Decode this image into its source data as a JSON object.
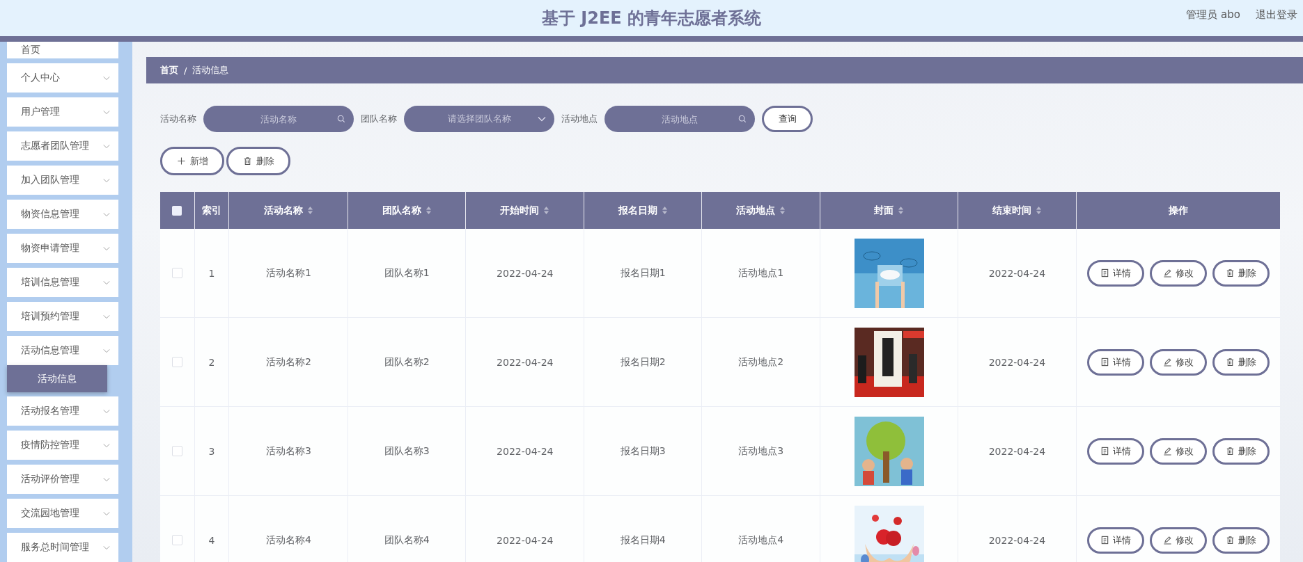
{
  "header": {
    "title": "基于 J2EE 的青年志愿者系统",
    "user": "管理员 abo",
    "logout": "退出登录"
  },
  "sidebar": {
    "items": [
      {
        "label": "首页",
        "kind": "link"
      },
      {
        "label": "个人中心",
        "kind": "menu"
      },
      {
        "label": "用户管理",
        "kind": "menu"
      },
      {
        "label": "志愿者团队管理",
        "kind": "menu"
      },
      {
        "label": "加入团队管理",
        "kind": "menu"
      },
      {
        "label": "物资信息管理",
        "kind": "menu"
      },
      {
        "label": "物资申请管理",
        "kind": "menu"
      },
      {
        "label": "培训信息管理",
        "kind": "menu"
      },
      {
        "label": "培训预约管理",
        "kind": "menu"
      },
      {
        "label": "活动信息管理",
        "kind": "menu",
        "children": [
          {
            "label": "活动信息",
            "selected": true
          }
        ]
      },
      {
        "label": "活动报名管理",
        "kind": "menu"
      },
      {
        "label": "疫情防控管理",
        "kind": "menu"
      },
      {
        "label": "活动评价管理",
        "kind": "menu"
      },
      {
        "label": "交流园地管理",
        "kind": "menu"
      },
      {
        "label": "服务总时间管理",
        "kind": "menu"
      }
    ]
  },
  "breadcrumb": {
    "items": [
      "首页",
      "活动信息"
    ],
    "separator": "/"
  },
  "search": {
    "fields": [
      {
        "label": "活动名称",
        "placeholder": "活动名称",
        "kind": "text"
      },
      {
        "label": "团队名称",
        "placeholder": "请选择团队名称",
        "kind": "select"
      },
      {
        "label": "活动地点",
        "placeholder": "活动地点",
        "kind": "text"
      }
    ],
    "button": "查询"
  },
  "actions": [
    {
      "label": "新增",
      "kind": "add"
    },
    {
      "label": "删除",
      "kind": "delete"
    }
  ],
  "table": {
    "select_all": {
      "checked": false
    },
    "columns": [
      {
        "label": "索引",
        "sortable": false
      },
      {
        "label": "活动名称",
        "sortable": true
      },
      {
        "label": "团队名称",
        "sortable": true
      },
      {
        "label": "开始时间",
        "sortable": true
      },
      {
        "label": "报名日期",
        "sortable": true
      },
      {
        "label": "活动地点",
        "sortable": true
      },
      {
        "label": "封面",
        "sortable": true
      },
      {
        "label": "结束时间",
        "sortable": true
      },
      {
        "label": "操作",
        "sortable": false
      }
    ],
    "rows": [
      {
        "checked": false,
        "cells": [
          "1",
          "活动名称1",
          "团队名称1",
          "2022-04-24",
          "报名日期1",
          "活动地点1",
          {
            "kind": "picture"
          },
          "2022-04-24"
        ],
        "ops": [
          {
            "label": "详情",
            "kind": "detail"
          },
          {
            "label": "修改",
            "kind": "edit"
          },
          {
            "label": "删除",
            "kind": "delete"
          }
        ]
      },
      {
        "checked": false,
        "cells": [
          "2",
          "活动名称2",
          "团队名称2",
          "2022-04-24",
          "报名日期2",
          "活动地点2",
          {
            "kind": "picture"
          },
          "2022-04-24"
        ],
        "ops": [
          {
            "label": "详情",
            "kind": "detail"
          },
          {
            "label": "修改",
            "kind": "edit"
          },
          {
            "label": "删除",
            "kind": "delete"
          }
        ]
      },
      {
        "checked": false,
        "cells": [
          "3",
          "活动名称3",
          "团队名称3",
          "2022-04-24",
          "报名日期3",
          "活动地点3",
          {
            "kind": "picture"
          },
          "2022-04-24"
        ],
        "ops": [
          {
            "label": "详情",
            "kind": "detail"
          },
          {
            "label": "修改",
            "kind": "edit"
          },
          {
            "label": "删除",
            "kind": "delete"
          }
        ]
      },
      {
        "checked": false,
        "cells": [
          "4",
          "活动名称4",
          "团队名称4",
          "2022-04-24",
          "报名日期4",
          "活动地点4",
          {
            "kind": "picture"
          },
          "2022-04-24"
        ],
        "ops": [
          {
            "label": "详情",
            "kind": "detail"
          },
          {
            "label": "修改",
            "kind": "edit"
          },
          {
            "label": "删除",
            "kind": "delete"
          }
        ]
      }
    ]
  }
}
